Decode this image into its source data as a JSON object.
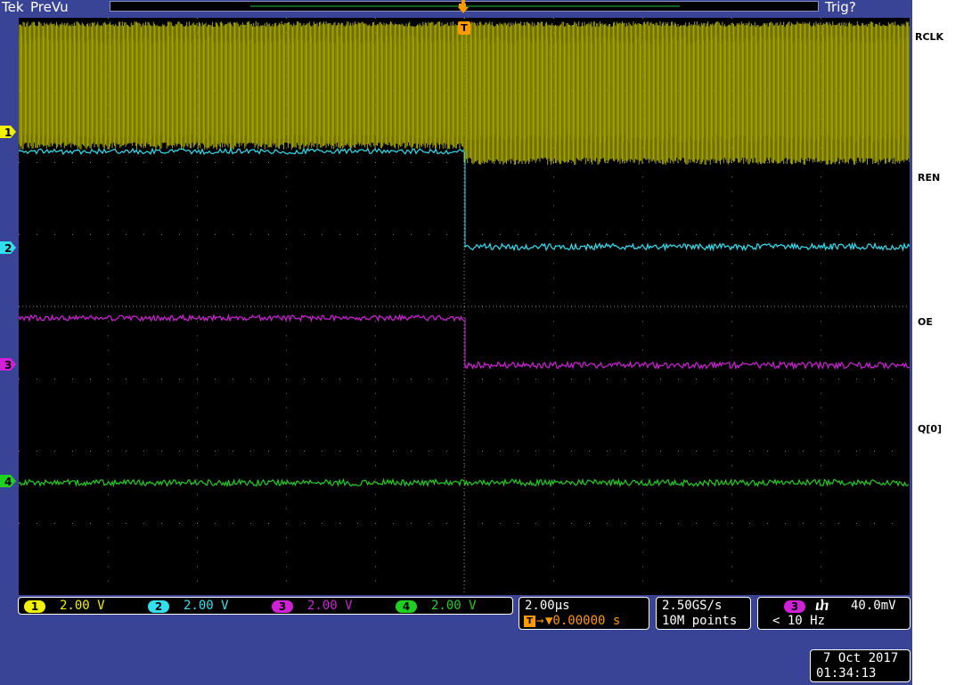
{
  "header": {
    "brand": "Tek",
    "mode": "PreVu",
    "trigger_status": "Trig?"
  },
  "trigger_marker": "T",
  "signal_labels": [
    "RCLK",
    "REN",
    "OE",
    "Q[0]"
  ],
  "channel_markers": [
    "1",
    "2",
    "3",
    "4"
  ],
  "channels": [
    {
      "num": "1",
      "scale": "2.00 V",
      "color": "#f2f200"
    },
    {
      "num": "2",
      "scale": "2.00 V",
      "color": "#30e0f0"
    },
    {
      "num": "3",
      "scale": "2.00 V",
      "color": "#d020d8"
    },
    {
      "num": "4",
      "scale": "2.00 V",
      "color": "#20d020"
    }
  ],
  "timebase": {
    "scale": "2.00µs",
    "trigger_position": "▼0.00000 s",
    "trigger_icon": "T"
  },
  "acquisition": {
    "sample_rate": "2.50GS/s",
    "record_length": "10M points"
  },
  "trigger": {
    "source": "3",
    "slope_icon": "falling-edge-icon",
    "slope_glyph": "ⴐ",
    "level": "40.0mV",
    "frequency": "< 10 Hz"
  },
  "datetime": {
    "date": "7 Oct  2017",
    "time": "01:34:13"
  },
  "colors": {
    "ch1": "#f2f200",
    "ch2": "#30e0f0",
    "ch3": "#d020d8",
    "ch4": "#20d020",
    "background": "#3a4496",
    "trigger": "#ff9900"
  }
}
